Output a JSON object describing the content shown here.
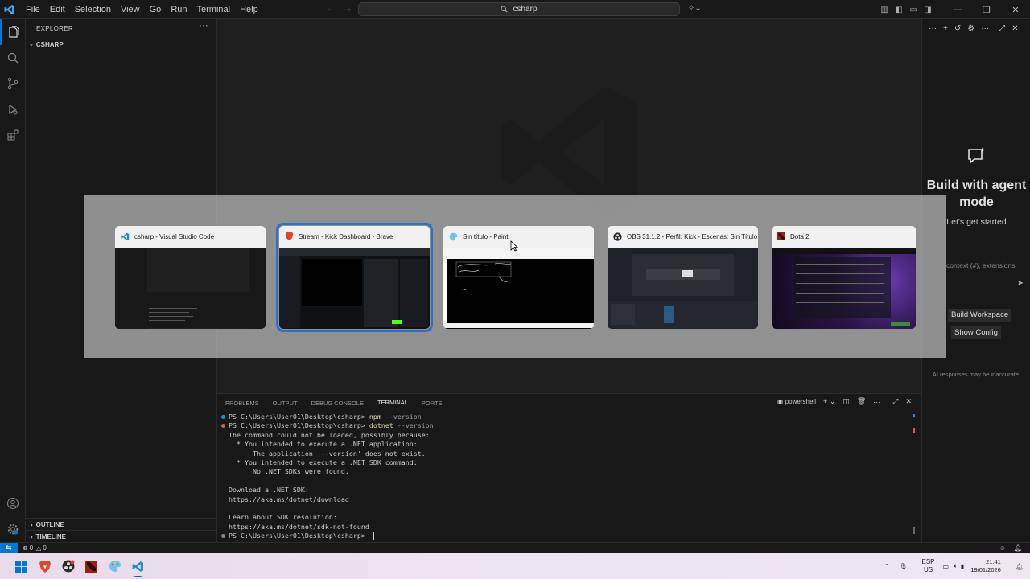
{
  "titlebar": {
    "menu": [
      "File",
      "Edit",
      "Selection",
      "View",
      "Go",
      "Run",
      "Terminal",
      "Help"
    ],
    "search_text": "csharp"
  },
  "sidebar": {
    "title": "EXPLORER",
    "folder": "CSHARP",
    "outline": "OUTLINE",
    "timeline": "TIMELINE"
  },
  "panel": {
    "tabs": [
      "PROBLEMS",
      "OUTPUT",
      "DEBUG CONSOLE",
      "TERMINAL",
      "PORTS"
    ],
    "active_tab": "TERMINAL",
    "shell": "powershell",
    "lines": [
      {
        "prompt": "PS C:\\Users\\User01\\Desktop\\csharp> ",
        "cmd": "npm",
        "args": " --version",
        "dot": "#2a8cd7"
      },
      {
        "prompt": "PS C:\\Users\\User01\\Desktop\\csharp> ",
        "cmd": "dotnet",
        "args": " --version",
        "dot": "#e05252"
      },
      {
        "text": "The command could not be loaded, possibly because:"
      },
      {
        "text": "  * You intended to execute a .NET application:"
      },
      {
        "text": "      The application '--version' does not exist."
      },
      {
        "text": "  * You intended to execute a .NET SDK command:"
      },
      {
        "text": "      No .NET SDKs were found."
      },
      {
        "text": ""
      },
      {
        "text": "Download a .NET SDK:"
      },
      {
        "text": "https://aka.ms/dotnet/download"
      },
      {
        "text": ""
      },
      {
        "text": "Learn about SDK resolution:"
      },
      {
        "text": "https://aka.ms/dotnet/sdk-not-found"
      },
      {
        "prompt": "PS C:\\Users\\User01\\Desktop\\csharp> ",
        "cmd": "",
        "args": "",
        "dot": "#888888"
      }
    ]
  },
  "chat": {
    "title": "Build with agent mode",
    "subtitle": "Let's get started",
    "input_placeholder": "context (#), extensions",
    "buttons": [
      "Build Workspace",
      "Show Config"
    ],
    "note": "AI responses may be inaccurate."
  },
  "statusbar": {
    "errors": "0",
    "warnings": "0"
  },
  "alttab": {
    "windows": [
      {
        "title": "csharp - Visual Studio Code",
        "icon": "vscode-icon",
        "selected": false
      },
      {
        "title": "Stream - Kick Dashboard - Brave",
        "icon": "brave-icon",
        "selected": true
      },
      {
        "title": "Sin título - Paint",
        "icon": "paint-icon",
        "selected": false
      },
      {
        "title": "OBS 31.1.2 - Perfil: Kick - Escenas: Sin Título",
        "icon": "obs-icon",
        "selected": false
      },
      {
        "title": "Dota 2",
        "icon": "dota-icon",
        "selected": false
      }
    ]
  },
  "taskbar": {
    "lang_top": "ESP",
    "lang_bottom": "US",
    "time": "21:41",
    "date": "19/01/2026"
  },
  "colors": {
    "accent": "#0078d4",
    "selection_outline": "#2a6fc9"
  }
}
